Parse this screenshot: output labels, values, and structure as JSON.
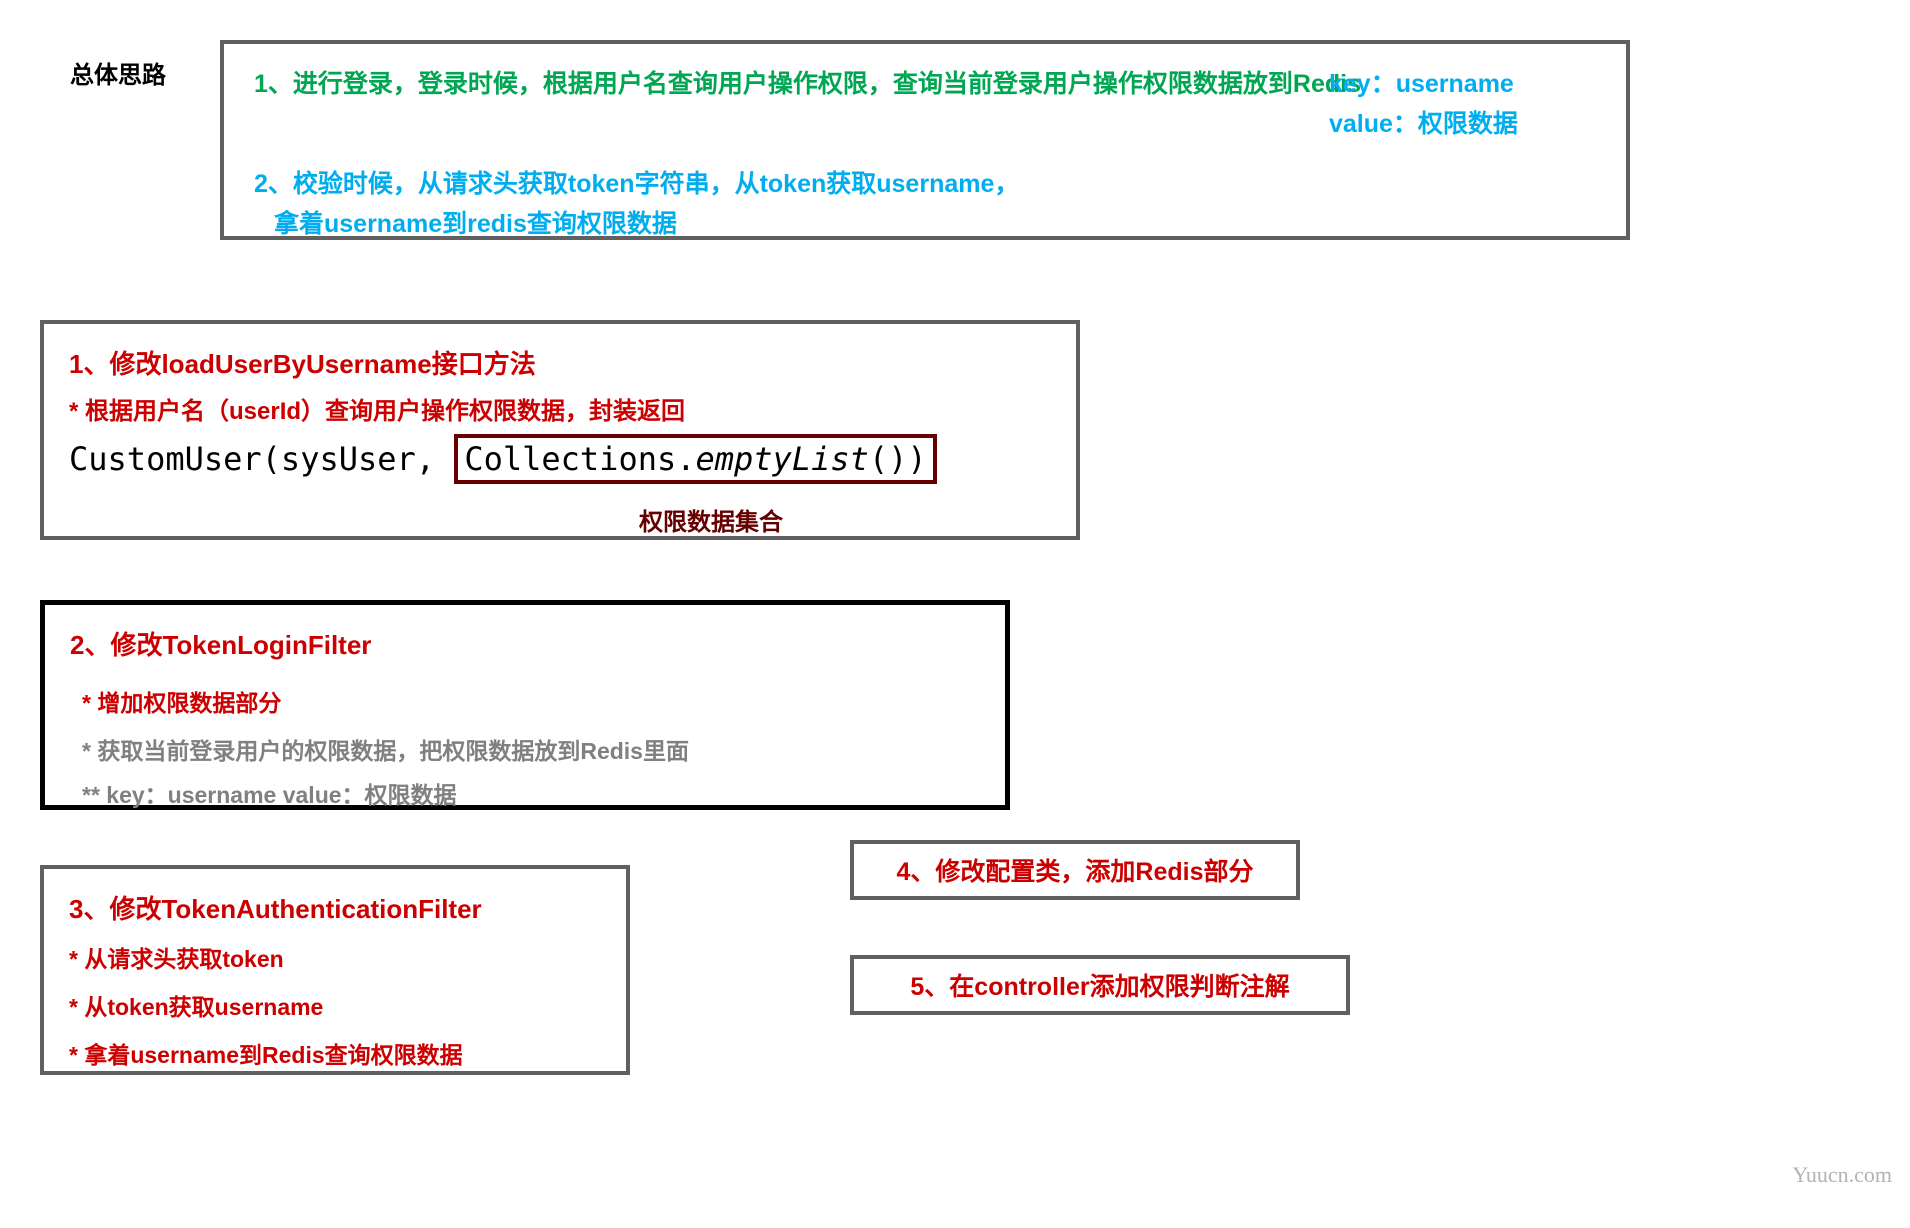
{
  "heading": "总体思路",
  "overall": {
    "step1_line1": "1、进行登录，登录时候，根据用户名查询用户操作权限，查询当前登录用户操作权限数据放到Redis",
    "step1_key": "key：username",
    "step1_value": "value：权限数据",
    "step2_line1": "2、校验时候，从请求头获取token字符串，从token获取username，",
    "step2_line2": "拿着username到redis查询权限数据"
  },
  "section1": {
    "title": "1、修改loadUserByUsername接口方法",
    "sub": "* 根据用户名（userId）查询用户操作权限数据，封装返回",
    "code_prefix": "CustomUser(sysUser, ",
    "code_hl_coll": "Collections.",
    "code_hl_em": "emptyList",
    "code_hl_suffix": "())",
    "label": "权限数据集合"
  },
  "section2": {
    "title": "2、修改TokenLoginFilter",
    "sub": "* 增加权限数据部分",
    "g1": "* 获取当前登录用户的权限数据，把权限数据放到Redis里面",
    "g2": "** key：username   value：权限数据"
  },
  "section3": {
    "title": "3、修改TokenAuthenticationFilter",
    "l1": "* 从请求头获取token",
    "l2": "* 从token获取username",
    "l3": "* 拿着username到Redis查询权限数据"
  },
  "section4": {
    "title": "4、修改配置类，添加Redis部分"
  },
  "section5": {
    "title": "5、在controller添加权限判断注解"
  },
  "watermark": "Yuucn.com"
}
